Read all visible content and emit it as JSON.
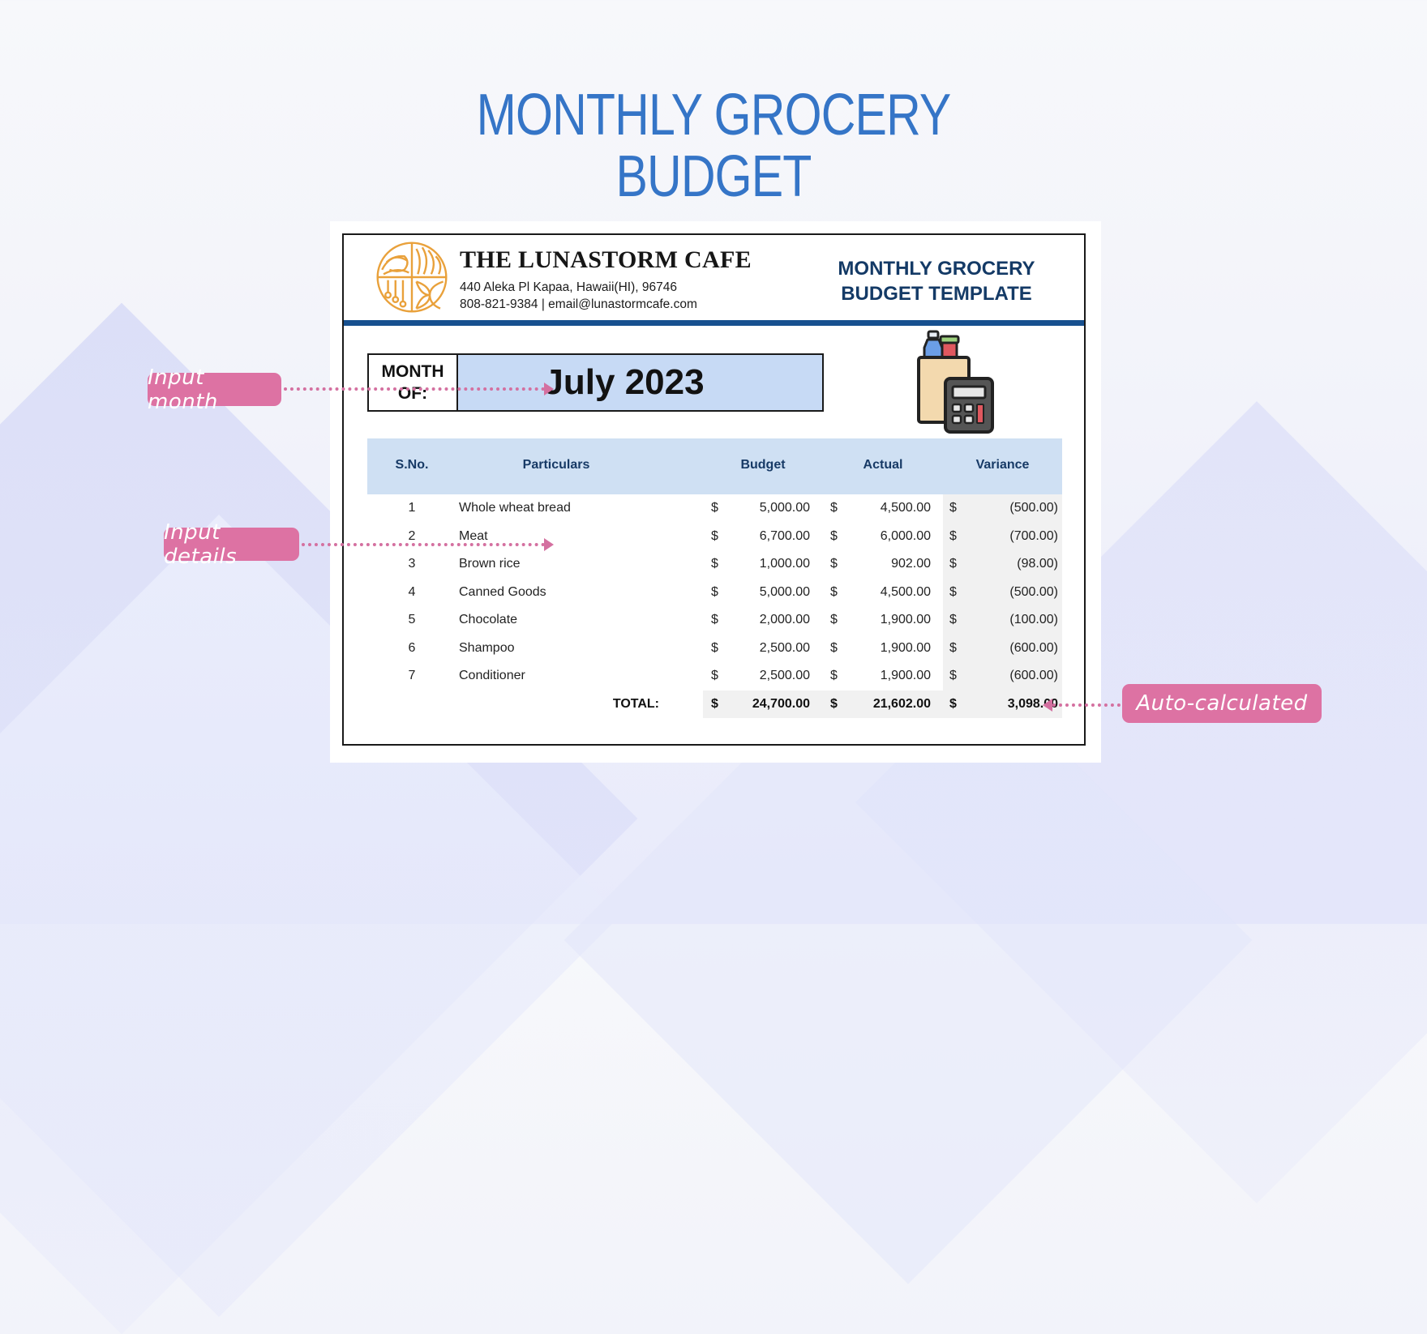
{
  "page": {
    "title_line1": "MONTHLY GROCERY",
    "title_line2": "BUDGET"
  },
  "header": {
    "company_name": "THE LUNASTORM CAFE",
    "address": "440 Aleka Pl Kapaa, Hawaii(HI), 96746",
    "contact": "808-821-9384 | email@lunastormcafe.com",
    "doc_title_line1": "MONTHLY GROCERY",
    "doc_title_line2": "BUDGET TEMPLATE",
    "logo_icon": "cafe-logo-icon",
    "accent_color": "#17508f",
    "logo_color": "#e9a13b"
  },
  "month": {
    "label_line1": "MONTH",
    "label_line2": "OF:",
    "value": "July 2023"
  },
  "table": {
    "columns": [
      "S.No.",
      "Particulars",
      "Budget",
      "Actual",
      "Variance"
    ],
    "currency": "$",
    "rows": [
      {
        "sno": "1",
        "particular": "Whole wheat bread",
        "budget": "5,000.00",
        "actual": "4,500.00",
        "variance": "(500.00)"
      },
      {
        "sno": "2",
        "particular": "Meat",
        "budget": "6,700.00",
        "actual": "6,000.00",
        "variance": "(700.00)"
      },
      {
        "sno": "3",
        "particular": "Brown rice",
        "budget": "1,000.00",
        "actual": "902.00",
        "variance": "(98.00)"
      },
      {
        "sno": "4",
        "particular": "Canned Goods",
        "budget": "5,000.00",
        "actual": "4,500.00",
        "variance": "(500.00)"
      },
      {
        "sno": "5",
        "particular": "Chocolate",
        "budget": "2,000.00",
        "actual": "1,900.00",
        "variance": "(100.00)"
      },
      {
        "sno": "6",
        "particular": "Shampoo",
        "budget": "2,500.00",
        "actual": "1,900.00",
        "variance": "(600.00)"
      },
      {
        "sno": "7",
        "particular": "Conditioner",
        "budget": "2,500.00",
        "actual": "1,900.00",
        "variance": "(600.00)"
      }
    ],
    "total": {
      "label": "TOTAL:",
      "budget": "24,700.00",
      "actual": "21,602.00",
      "variance": "3,098.00"
    },
    "header_bg": "#cfe0f3"
  },
  "annotations": {
    "input_month": "Input month",
    "input_details": "Input details",
    "auto_calculated": "Auto-calculated",
    "color": "#dd72a3"
  }
}
